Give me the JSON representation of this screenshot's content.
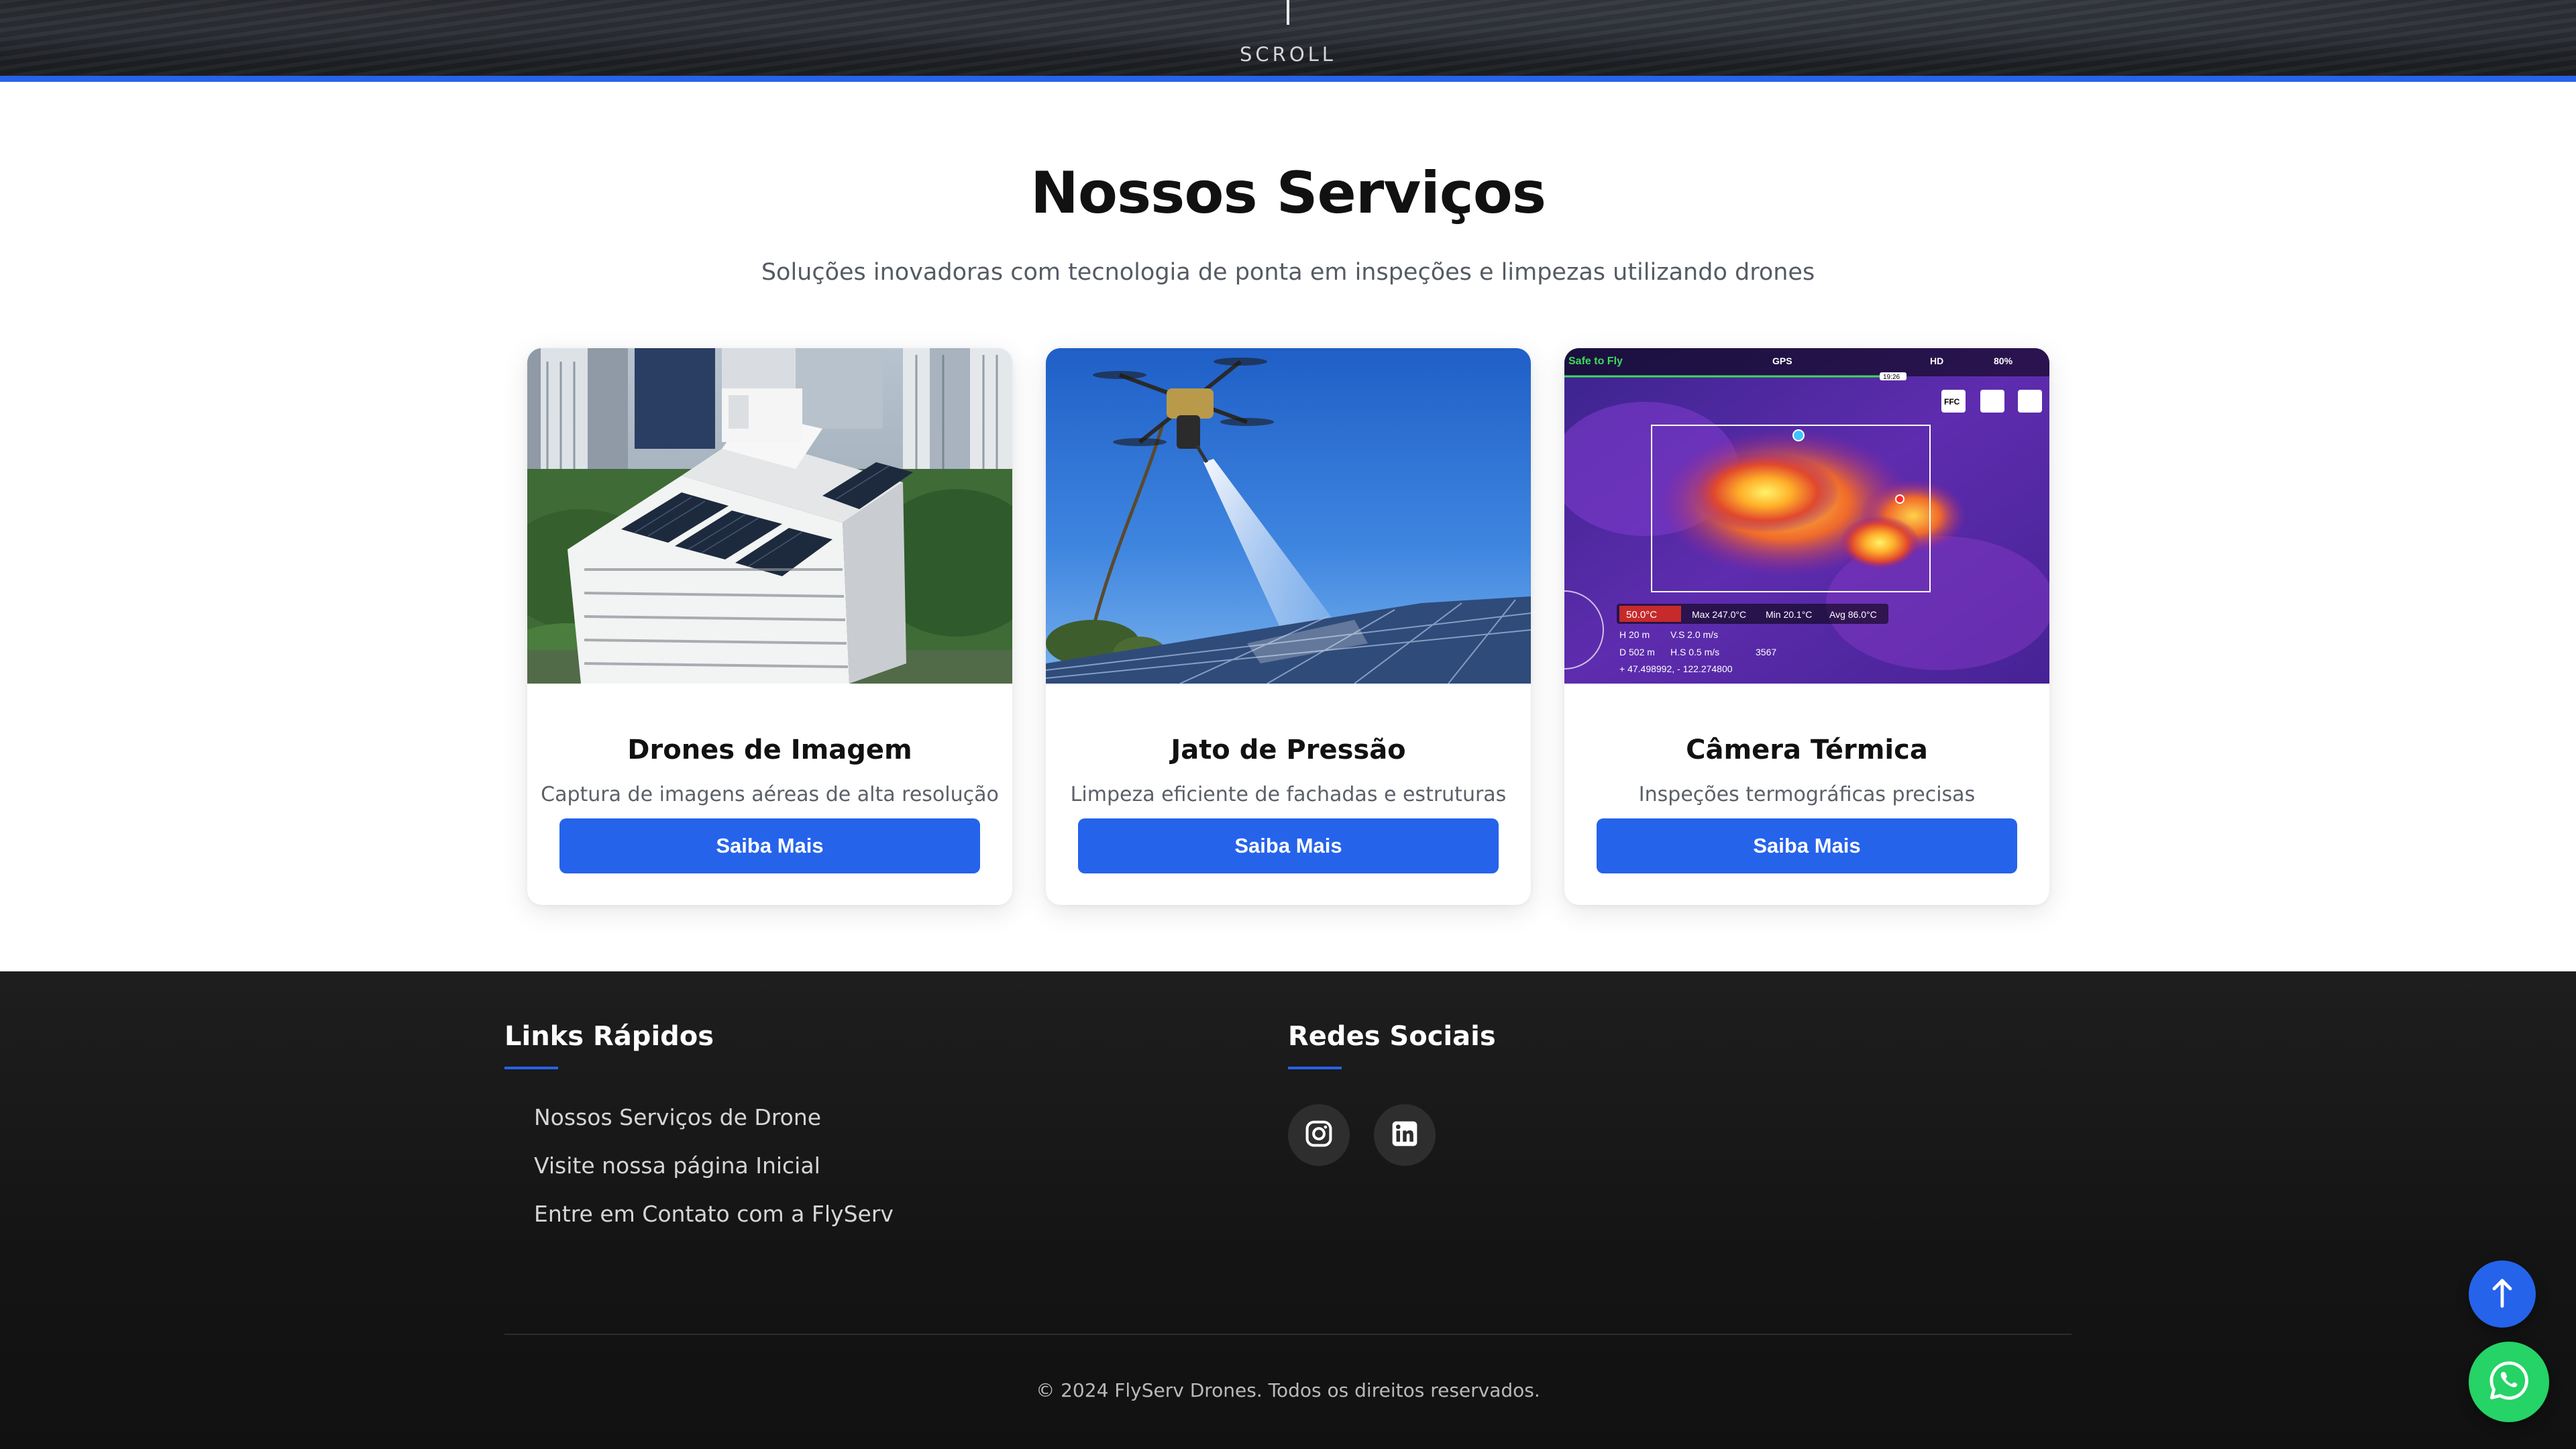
{
  "hero": {
    "scroll_label": "SCROLL"
  },
  "services": {
    "title": "Nossos Serviços",
    "subtitle": "Soluções inovadoras com tecnologia de ponta em inspeções e limpezas utilizando drones",
    "cards": [
      {
        "title": "Drones de Imagem",
        "description": "Captura de imagens aéreas de alta resolução",
        "button_label": "Saiba Mais",
        "image": "aerial-building-solar-roof-photo"
      },
      {
        "title": "Jato de Pressão",
        "description": "Limpeza eficiente de fachadas e estruturas",
        "button_label": "Saiba Mais",
        "image": "drone-spraying-solar-panels-photo"
      },
      {
        "title": "Câmera Térmica",
        "description": "Inspeções termográficas precisas",
        "button_label": "Saiba Mais",
        "image": "thermal-camera-view-screenshot",
        "thermal_overlay": {
          "status": "Safe to Fly",
          "gps": "GPS",
          "battery": "80%",
          "time": "19:26",
          "ffc": "FFC",
          "spot_temp": "50.0°C",
          "max_label": "Max",
          "max_temp": "247.0°C",
          "min_label": "Min",
          "min_temp": "20.1°C",
          "avg_label": "Avg",
          "avg_temp": "86.0°C",
          "height": "H 20 m",
          "vertical_speed": "V.S 2.0 m/s",
          "distance": "D 502 m",
          "horizontal_speed": "H.S 0.5 m/s",
          "frame": "3567",
          "coordinates": "+ 47.498992, - 122.274800"
        }
      }
    ]
  },
  "footer": {
    "quick_links": {
      "heading": "Links Rápidos",
      "items": [
        "Nossos Serviços de Drone",
        "Visite nossa página Inicial",
        "Entre em Contato com a FlyServ"
      ]
    },
    "social": {
      "heading": "Redes Sociais",
      "icons": [
        "instagram-icon",
        "linkedin-icon"
      ]
    },
    "copyright": "© 2024 FlyServ Drones. Todos os direitos reservados."
  },
  "floating": {
    "back_to_top_icon": "arrow-up-icon",
    "whatsapp_icon": "whatsapp-icon"
  },
  "colors": {
    "accent": "#2563eb",
    "footer_bg": "#161616",
    "whatsapp": "#25d366"
  }
}
